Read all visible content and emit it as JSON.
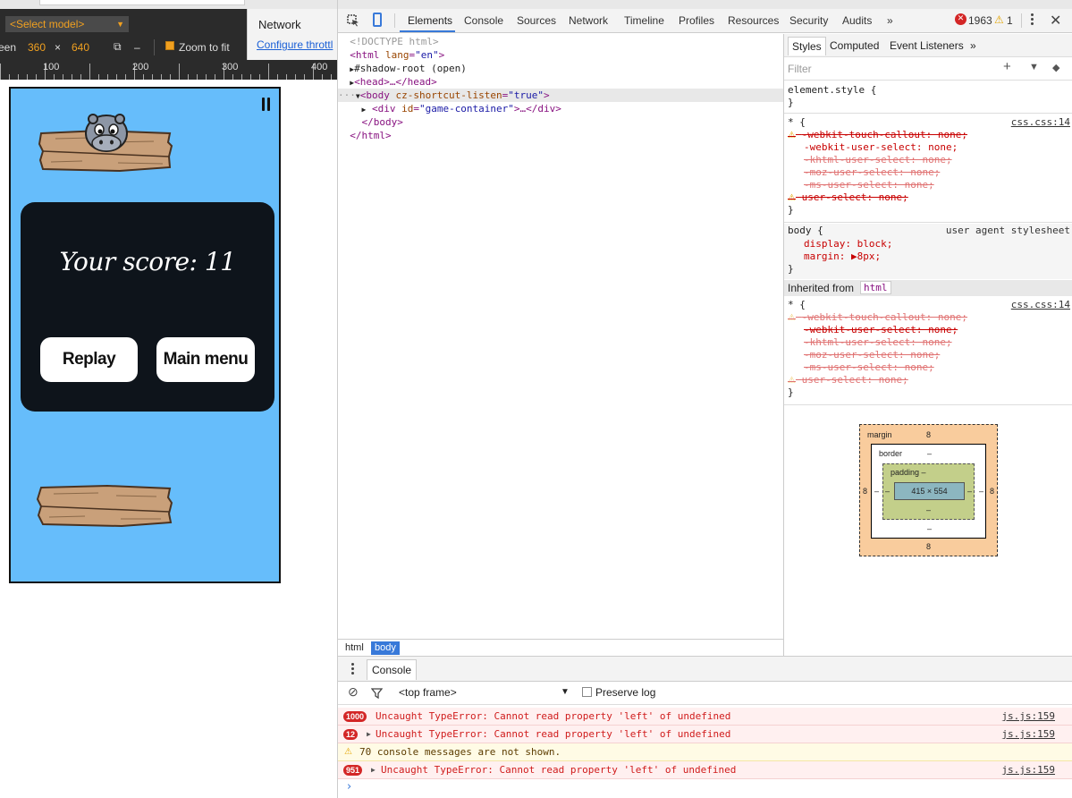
{
  "device": {
    "model_select": "<Select model>",
    "screen_label": "een",
    "width": "360",
    "times": "×",
    "height": "640",
    "dash": "–",
    "zoom_label": "Zoom to fit",
    "network_title": "Network",
    "throttle_link": "Configure throttl",
    "ruler": [
      "100",
      "200",
      "300",
      "400"
    ]
  },
  "game": {
    "score_text": "Your score: 11",
    "replay_label": "Replay",
    "main_menu_label": "Main menu",
    "mascot": "hippo",
    "background_color": "#66bdfb"
  },
  "devtools": {
    "tabs": [
      "Elements",
      "Console",
      "Sources",
      "Network",
      "Timeline",
      "Profiles",
      "Resources",
      "Security",
      "Audits"
    ],
    "more_tabs": "»",
    "error_count": "1963",
    "warning_count": "1",
    "error_glyph": "✕",
    "warning_glyph": "⚠",
    "kebab": "⋮",
    "dom": {
      "doctype": "<!DOCTYPE html>",
      "html_open_tag": "<html",
      "html_attr": "lang",
      "html_attr_val": "\"en\"",
      "html_close_bracket": ">",
      "shadow_root": "#shadow-root (open)",
      "head_line": "<head>…</head>",
      "body_open_tag": "<body",
      "body_attr": "cz-shortcut-listen",
      "body_attr_val": "\"true\"",
      "body_close_bracket": ">",
      "div_open_tag": "<div",
      "div_attr": "id",
      "div_attr_val": "\"game-container\"",
      "div_rest": ">…</div>",
      "body_close": "</body>",
      "html_close": "</html>"
    },
    "breadcrumb": [
      "html",
      "body"
    ],
    "styles": {
      "tabs": [
        "Styles",
        "Computed",
        "Event Listeners"
      ],
      "more": "»",
      "filter_placeholder": "Filter",
      "add_icon": "+",
      "pin_icon": "📌",
      "element_style": "element.style {",
      "close_brace": "}",
      "star_rule": "* {",
      "star_source": "css.css:14",
      "star_props": [
        "-webkit-touch-callout: none;",
        "-webkit-user-select: none;",
        "-khtml-user-select: none;",
        "-moz-user-select: none;",
        "-ms-user-select: none;",
        "user-select: none;"
      ],
      "body_rule": "body {",
      "body_source": "user agent stylesheet",
      "body_display": "display: block;",
      "body_margin": "margin: ▶8px;",
      "inherited_from": "Inherited from",
      "inherited_tag": "html"
    },
    "box_model": {
      "margin_label": "margin",
      "margin_top": "8",
      "margin_bottom": "8",
      "margin_left": "8",
      "margin_right": "8",
      "border_label": "border",
      "border_top": "–",
      "border_bottom": "–",
      "border_left": "–",
      "border_right": "–",
      "padding_label": "padding –",
      "padding_bottom": "–",
      "padding_left": "–",
      "padding_right": "–",
      "content": "415 × 554"
    },
    "console": {
      "tab": "Console",
      "context": "<top frame>",
      "preserve_log": "Preserve log",
      "messages": [
        {
          "count": "1000",
          "text": "Uncaught TypeError: Cannot read property 'left' of undefined",
          "source": "js.js:159"
        },
        {
          "count": "12",
          "text": "Uncaught TypeError: Cannot read property 'left' of undefined",
          "source": "js.js:159"
        },
        {
          "count": "",
          "text": "70 console messages are not shown.",
          "source": ""
        },
        {
          "count": "951",
          "text": "Uncaught TypeError: Cannot read property 'left' of undefined",
          "source": "js.js:159"
        }
      ],
      "prompt": "›"
    }
  }
}
